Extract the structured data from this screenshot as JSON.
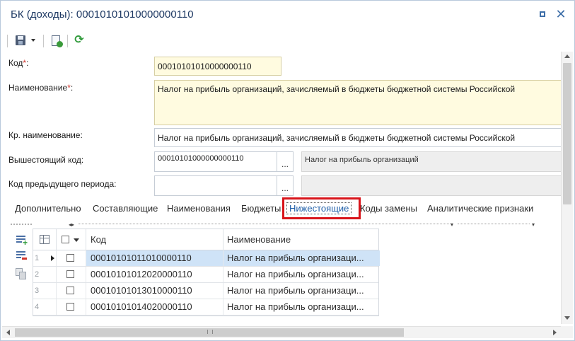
{
  "window": {
    "title": "БК (доходы): 00010101010000000110",
    "restore_icon": "restore-icon",
    "close_glyph": "✕"
  },
  "toolbar": {
    "save_icon": "save-icon",
    "dropdown_icon": "chevron-down-icon",
    "check_doc_icon": "document-check-icon",
    "refresh_icon": "refresh-icon",
    "refresh_glyph": "⟳"
  },
  "form": {
    "code_label": "Код",
    "code_value": "00010101010000000110",
    "name_label": "Наименование",
    "name_value": "Налог на прибыль организаций, зачисляемый в бюджеты бюджетной системы Российской",
    "short_name_label": "Кр. наименование:",
    "short_name_value": "Налог на прибыль организаций, зачисляемый в бюджеты бюджетной системы Российской",
    "parent_code_label": "Вышестоящий код:",
    "parent_code_value": "00010101000000000110",
    "parent_name_value": "Налог на прибыль организаций",
    "prev_code_label": "Код предыдущего периода:",
    "prev_code_value": "",
    "prev_name_value": "",
    "ellipsis": "...",
    "required_mark": "*",
    "colon": ":"
  },
  "tabs": [
    {
      "label": "Дополнительно"
    },
    {
      "label": "Составляющие"
    },
    {
      "label": "Наименования"
    },
    {
      "label": "Бюджеты"
    },
    {
      "label": "Нижестоящие",
      "active": true
    },
    {
      "label": "Коды замены"
    },
    {
      "label": "Аналитические признаки"
    }
  ],
  "grid": {
    "columns": {
      "code": "Код",
      "name": "Наименование"
    },
    "rows": [
      {
        "num": "1",
        "code": "00010101011010000110",
        "name": "Налог на прибыль организаци...",
        "selected": true
      },
      {
        "num": "2",
        "code": "00010101012020000110",
        "name": "Налог на прибыль организаци..."
      },
      {
        "num": "3",
        "code": "00010101013010000110",
        "name": "Налог на прибыль организаци..."
      },
      {
        "num": "4",
        "code": "00010101014020000110",
        "name": "Налог на прибыль организаци..."
      }
    ]
  },
  "colors": {
    "accent": "#1f5fa8",
    "title": "#1f3a64",
    "required": "#d0342c",
    "highlight": "#d8141a",
    "selected_row": "#cfe3f7",
    "yellow_field": "#fffbe0"
  }
}
